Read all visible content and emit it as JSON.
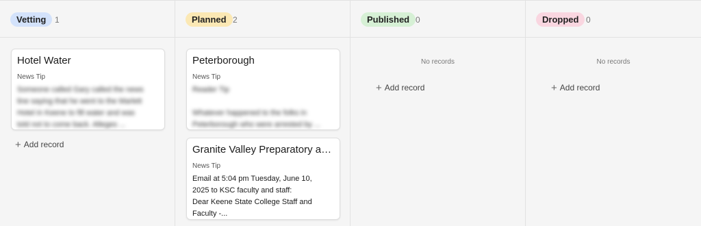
{
  "columns": [
    {
      "name": "Vetting",
      "count": "1",
      "color": "#d3e2fb",
      "cards": [
        {
          "title": "Hotel Water",
          "label": "News Tip",
          "body_lines": [
            "Someone called Gary called the news",
            "line saying that he went to the Marlett",
            "Hotel in Keene to fill water and was",
            "told not to come back. Alleges ..."
          ]
        }
      ],
      "add_label": "Add record",
      "empty_label": ""
    },
    {
      "name": "Planned",
      "count": "2",
      "color": "#fbe8b4",
      "cards": [
        {
          "title": "Peterborough",
          "label": "News Tip",
          "subtitle": "Reader Tip",
          "body_lines": [
            "Whatever happened to the folks in",
            "Peterborough who were arrested by ..."
          ]
        },
        {
          "title": "Granite Valley Preparatory at ...",
          "label": "News Tip",
          "body_lines": [
            "Email at 5:04 pm Tuesday, June 10,",
            "2025 to KSC faculty and staff:",
            "Dear Keene State College Staff and",
            "Faculty -..."
          ]
        }
      ],
      "add_label": "",
      "empty_label": ""
    },
    {
      "name": "Published",
      "count": "0",
      "color": "#d6f0d5",
      "cards": [],
      "add_label": "Add record",
      "empty_label": "No records"
    },
    {
      "name": "Dropped",
      "count": "0",
      "color": "#f9d6e0",
      "cards": [],
      "add_label": "Add record",
      "empty_label": "No records"
    }
  ],
  "icons": {
    "add": "plus-icon"
  }
}
